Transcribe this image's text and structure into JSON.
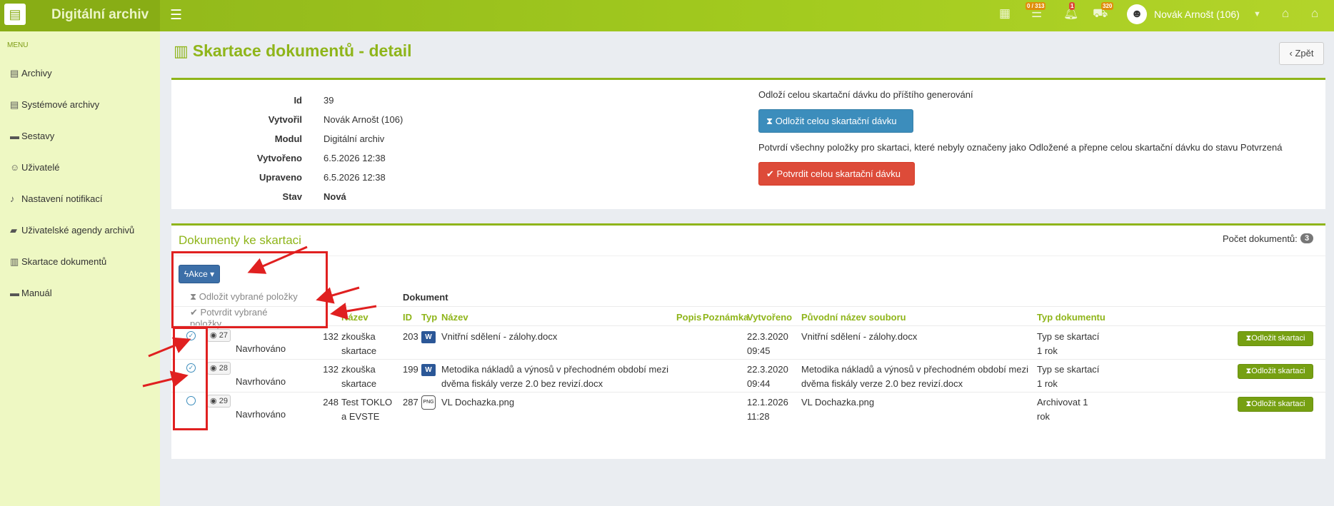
{
  "app": {
    "title": "Digitální archiv"
  },
  "topbar": {
    "tasks_badge": "0 / 313",
    "notif_badge": "1",
    "cart_badge": "320",
    "user_name": "Novák Arnošt (106)"
  },
  "sidebar": {
    "menu_label": "MENU",
    "items": [
      {
        "label": "Archivy"
      },
      {
        "label": "Systémové archivy"
      },
      {
        "label": "Sestavy"
      },
      {
        "label": "Uživatelé"
      },
      {
        "label": "Nastavení notifikací"
      },
      {
        "label": "Uživatelské agendy archivů"
      },
      {
        "label": "Skartace dokumentů"
      },
      {
        "label": "Manuál"
      }
    ]
  },
  "page": {
    "title": "Skartace dokumentů - detail",
    "back_label": "Zpět"
  },
  "detail": {
    "labels": {
      "id": "Id",
      "created_by": "Vytvořil",
      "module": "Modul",
      "created": "Vytvořeno",
      "modified": "Upraveno",
      "state": "Stav"
    },
    "values": {
      "id": "39",
      "created_by": "Novák Arnošt (106)",
      "module": "Digitální archiv",
      "created": "6.5.2026 12:38",
      "modified": "6.5.2026 12:38",
      "state": "Nová"
    },
    "postpone_desc": "Odloží celou skartační dávku do příštího generování",
    "postpone_all_label": "Odložit celou skartační dávku",
    "confirm_desc": "Potvrdí všechny položky pro skartaci, které nebyly označeny jako Odložené a přepne celou skartační dávku do stavu Potvrzená",
    "confirm_all_label": "Potvrdit celou skartační dávku"
  },
  "documents": {
    "title": "Dokumenty ke skartaci",
    "count_label": "Počet dokumentů:",
    "count": "3",
    "actions_label": "Akce",
    "actions_menu": [
      "Odložit vybrané položky",
      "Potvrdit vybrané položky"
    ],
    "group_header": "Dokument",
    "columns": {
      "nazev_group": "Název",
      "id": "ID",
      "typ": "Typ",
      "nazev": "Název",
      "popis": "Popis",
      "poznamka": "Poznámka",
      "vytvoreno": "Vytvořeno",
      "puvodni": "Původní název souboru",
      "typ_dokumentu": "Typ dokumentu"
    },
    "rows": [
      {
        "selected": true,
        "views": "27",
        "state": "Navrhováno",
        "agenda_id": "132",
        "agenda_name": "zkouška skartace",
        "doc_id": "203",
        "type_icon": "word-icon",
        "name": "Vnitřní sdělení - zálohy.docx",
        "created": "22.3.2020 09:45",
        "original": "Vnitřní sdělení - zálohy.docx",
        "doc_type": "Typ se skartací 1 rok",
        "action_label": "Odložit skartaci"
      },
      {
        "selected": true,
        "views": "28",
        "state": "Navrhováno",
        "agenda_id": "132",
        "agenda_name": "zkouška skartace",
        "doc_id": "199",
        "type_icon": "word-icon",
        "name": "Metodika nákladů a výnosů v přechodném období mezi dvěma fiskály verze 2.0 bez revizí.docx",
        "created": "22.3.2020 09:44",
        "original": "Metodika nákladů a výnosů v přechodném období mezi dvěma fiskály verze 2.0 bez revizí.docx",
        "doc_type": "Typ se skartací 1 rok",
        "action_label": "Odložit skartaci"
      },
      {
        "selected": false,
        "views": "29",
        "state": "Navrhováno",
        "agenda_id": "248",
        "agenda_name": "Test TOKLO a EVSTE",
        "doc_id": "287",
        "type_icon": "png-icon",
        "name": "VL Dochazka.png",
        "created": "12.1.2026 11:28",
        "original": "VL Dochazka.png",
        "doc_type": "Archivovat 1 rok",
        "action_label": "Odložit skartaci"
      }
    ]
  },
  "colors": {
    "brand": "#8fb51a",
    "sidebar": "#eef8c3",
    "primary": "#3c8dbc",
    "danger": "#dd4b39",
    "annotation": "#e02020"
  }
}
